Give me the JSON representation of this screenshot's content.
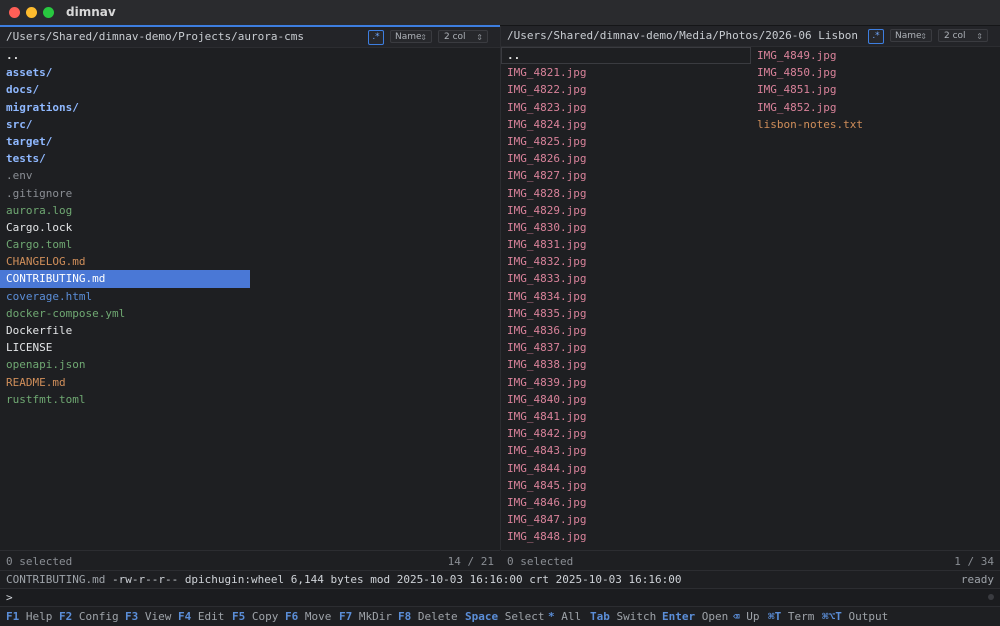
{
  "app": {
    "title": "dimnav"
  },
  "left_pane": {
    "path": "/Users/Shared/dimnav-demo/Projects/aurora-cms",
    "regex_label": ".*",
    "sort": "Name",
    "cols": "2 col",
    "files": [
      {
        "name": "..",
        "kind": "parent"
      },
      {
        "name": "assets/",
        "kind": "dir"
      },
      {
        "name": "docs/",
        "kind": "dir"
      },
      {
        "name": "migrations/",
        "kind": "dir"
      },
      {
        "name": "src/",
        "kind": "dir"
      },
      {
        "name": "target/",
        "kind": "dir"
      },
      {
        "name": "tests/",
        "kind": "dir"
      },
      {
        "name": ".env",
        "kind": "hidden"
      },
      {
        "name": ".gitignore",
        "kind": "hidden"
      },
      {
        "name": "aurora.log",
        "kind": "green"
      },
      {
        "name": "Cargo.lock",
        "kind": "white"
      },
      {
        "name": "Cargo.toml",
        "kind": "green"
      },
      {
        "name": "CHANGELOG.md",
        "kind": "orange"
      },
      {
        "name": "CONTRIBUTING.md",
        "kind": "selected"
      },
      {
        "name": "coverage.html",
        "kind": "blue"
      },
      {
        "name": "docker-compose.yml",
        "kind": "green"
      },
      {
        "name": "Dockerfile",
        "kind": "white"
      },
      {
        "name": "LICENSE",
        "kind": "white"
      },
      {
        "name": "openapi.json",
        "kind": "green"
      },
      {
        "name": "README.md",
        "kind": "orange"
      },
      {
        "name": "rustfmt.toml",
        "kind": "green"
      }
    ],
    "selected_count": "0 selected",
    "position": "14 / 21"
  },
  "right_pane": {
    "path": "/Users/Shared/dimnav-demo/Media/Photos/2026-06 Lisbon",
    "regex_label": ".*",
    "sort": "Name",
    "cols": "2 col",
    "col1": [
      {
        "name": "..",
        "kind": "parent-cursor"
      },
      {
        "name": "IMG_4821.jpg",
        "kind": "pink"
      },
      {
        "name": "IMG_4822.jpg",
        "kind": "pink"
      },
      {
        "name": "IMG_4823.jpg",
        "kind": "pink"
      },
      {
        "name": "IMG_4824.jpg",
        "kind": "pink"
      },
      {
        "name": "IMG_4825.jpg",
        "kind": "pink"
      },
      {
        "name": "IMG_4826.jpg",
        "kind": "pink"
      },
      {
        "name": "IMG_4827.jpg",
        "kind": "pink"
      },
      {
        "name": "IMG_4828.jpg",
        "kind": "pink"
      },
      {
        "name": "IMG_4829.jpg",
        "kind": "pink"
      },
      {
        "name": "IMG_4830.jpg",
        "kind": "pink"
      },
      {
        "name": "IMG_4831.jpg",
        "kind": "pink"
      },
      {
        "name": "IMG_4832.jpg",
        "kind": "pink"
      },
      {
        "name": "IMG_4833.jpg",
        "kind": "pink"
      },
      {
        "name": "IMG_4834.jpg",
        "kind": "pink"
      },
      {
        "name": "IMG_4835.jpg",
        "kind": "pink"
      },
      {
        "name": "IMG_4836.jpg",
        "kind": "pink"
      },
      {
        "name": "IMG_4837.jpg",
        "kind": "pink"
      },
      {
        "name": "IMG_4838.jpg",
        "kind": "pink"
      },
      {
        "name": "IMG_4839.jpg",
        "kind": "pink"
      },
      {
        "name": "IMG_4840.jpg",
        "kind": "pink"
      },
      {
        "name": "IMG_4841.jpg",
        "kind": "pink"
      },
      {
        "name": "IMG_4842.jpg",
        "kind": "pink"
      },
      {
        "name": "IMG_4843.jpg",
        "kind": "pink"
      },
      {
        "name": "IMG_4844.jpg",
        "kind": "pink"
      },
      {
        "name": "IMG_4845.jpg",
        "kind": "pink"
      },
      {
        "name": "IMG_4846.jpg",
        "kind": "pink"
      },
      {
        "name": "IMG_4847.jpg",
        "kind": "pink"
      },
      {
        "name": "IMG_4848.jpg",
        "kind": "pink"
      }
    ],
    "col2": [
      {
        "name": "IMG_4849.jpg",
        "kind": "pink"
      },
      {
        "name": "IMG_4850.jpg",
        "kind": "pink"
      },
      {
        "name": "IMG_4851.jpg",
        "kind": "pink"
      },
      {
        "name": "IMG_4852.jpg",
        "kind": "pink"
      },
      {
        "name": "lisbon-notes.txt",
        "kind": "orange"
      }
    ],
    "selected_count": "0 selected",
    "position": "1 / 34"
  },
  "info": {
    "filename": "CONTRIBUTING.md",
    "details": " -rw-r--r-- dpichugin:wheel 6,144 bytes mod 2025-10-03 16:16:00 crt 2025-10-03 16:16:00",
    "state": "ready"
  },
  "command": {
    "prompt": ">"
  },
  "keybar": [
    {
      "key": "F1",
      "label": "Help",
      "name": "help"
    },
    {
      "key": "F2",
      "label": "Config",
      "name": "config"
    },
    {
      "key": "F3",
      "label": "View",
      "name": "view"
    },
    {
      "key": "F4",
      "label": "Edit",
      "name": "edit"
    },
    {
      "key": "F5",
      "label": "Copy",
      "name": "copy"
    },
    {
      "key": "F6",
      "label": "Move",
      "name": "move"
    },
    {
      "key": "F7",
      "label": "MkDir",
      "name": "mkdir"
    },
    {
      "key": "F8",
      "label": "Delete",
      "name": "delete"
    },
    {
      "key": "Space",
      "label": "Select",
      "name": "select"
    },
    {
      "key": "*",
      "label": "All",
      "name": "all"
    },
    {
      "key": "Tab",
      "label": "Switch",
      "name": "switch"
    },
    {
      "key": "Enter",
      "label": "Open",
      "name": "open"
    },
    {
      "key": "⌫",
      "label": "Up",
      "name": "up"
    },
    {
      "key": "⌘T",
      "label": "Term",
      "name": "term"
    },
    {
      "key": "⌘⌥T",
      "label": "Output",
      "name": "output"
    }
  ]
}
